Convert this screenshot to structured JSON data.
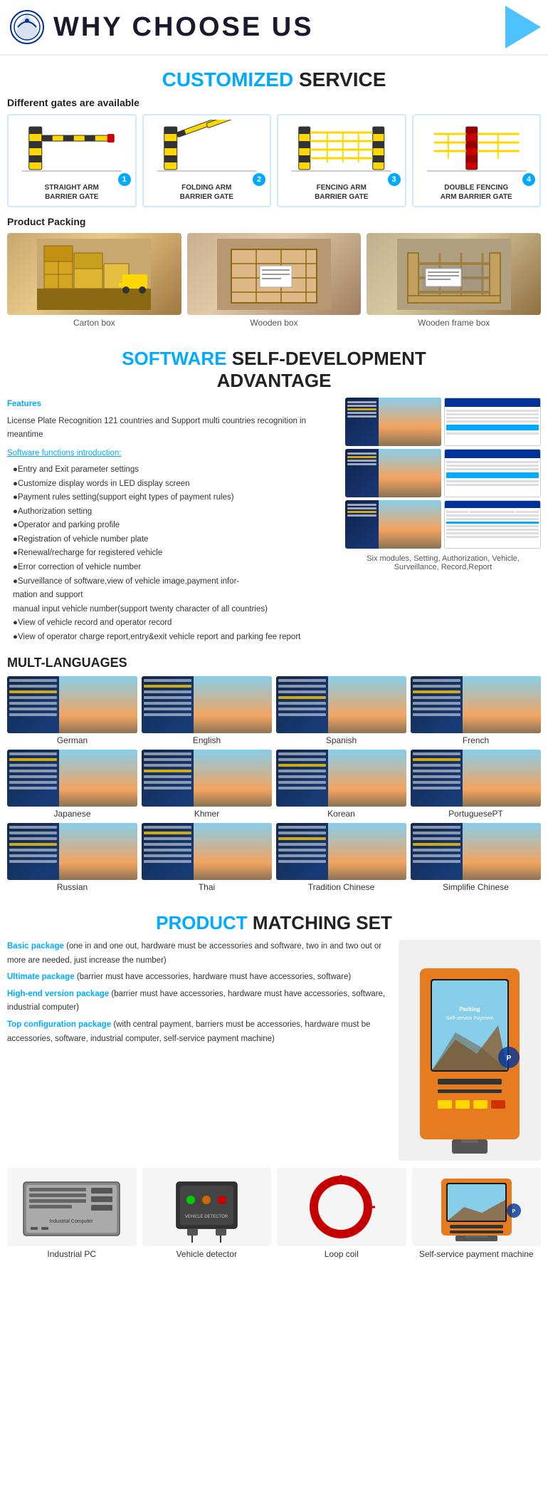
{
  "header": {
    "title": "WHY CHOOSE US"
  },
  "customized_service": {
    "section_title_colored": "CUSTOMIZED",
    "section_title_normal": " SERVICE",
    "gates_label": "Different gates are available",
    "gates": [
      {
        "num": "1",
        "label": "STRAIGHT ARM\nBARRIER GATE"
      },
      {
        "num": "2",
        "label": "FOLDING ARM\nBARRIER GATE"
      },
      {
        "num": "3",
        "label": "FENCING ARM\nBARRIER GATE"
      },
      {
        "num": "4",
        "label": "DOUBLE FENCING\nARM BARRIER GATE"
      }
    ],
    "packing_label": "Product Packing",
    "packing_items": [
      {
        "label": "Carton box"
      },
      {
        "label": "Wooden box"
      },
      {
        "label": "Wooden frame box"
      }
    ]
  },
  "software": {
    "title_colored": "SOFTWARE",
    "title_normal": " SELF-DEVELOPMENT\nADVANTAGE",
    "features_title": "Features",
    "features_intro": "License Plate Recognition 121 countries and Support multi countries recognition in meantime",
    "functions_title": "Software functions introduction:",
    "functions": [
      "Entry and Exit parameter settings",
      "Customize display words in LED display screen",
      "Payment rules setting(support eight types of  payment rules)",
      "Authorization setting",
      "Operator and parking profile",
      "Registration of vehicle number plate",
      "Renewal/recharge for registered vehicle",
      "Error correction of vehicle number",
      "Surveillance of software,view of vehicle image,payment information and support",
      "manual input vehicle number(support twenty character of all countries)",
      "View of vehicle record and operator record",
      "View of operator charge report,entry&exit vehicle report and parking fee report"
    ],
    "screens_caption": "Six modules, Setting, Authorization, Vehicle,\nSurveillance, Record,Report"
  },
  "languages": {
    "title": "MULT-LANGUAGES",
    "items": [
      {
        "label": "German"
      },
      {
        "label": "English"
      },
      {
        "label": "Spanish"
      },
      {
        "label": "French"
      },
      {
        "label": "Japanese"
      },
      {
        "label": "Khmer"
      },
      {
        "label": "Korean"
      },
      {
        "label": "PortuguesePT"
      },
      {
        "label": "Russian"
      },
      {
        "label": "Thai"
      },
      {
        "label": "Tradition Chinese"
      },
      {
        "label": "Simplifie Chinese"
      }
    ]
  },
  "product": {
    "title_colored": "PRODUCT",
    "title_normal": " MATCHING SET",
    "packages": [
      {
        "title": "Basic package",
        "desc": "(one in and one out, hardware must be accessories and software, two in and two out or more are needed, just increase the number)"
      },
      {
        "title": "Ultimate package",
        "desc": "(barrier must have accessories, hardware must have accessories, software)"
      },
      {
        "title": "High-end version package",
        "desc": "(barrier must have accessories, hardware must have accessories, software, industrial computer)"
      },
      {
        "title": "Top configuration package",
        "desc": "(with central payment, barriers must be accessories, hardware must be accessories, software, industrial computer, self-service payment machine)"
      }
    ],
    "hardware": [
      {
        "label": "Industrial PC"
      },
      {
        "label": "Vehicle detector"
      },
      {
        "label": "Loop coil"
      },
      {
        "label": "Self-service payment machine"
      }
    ]
  }
}
